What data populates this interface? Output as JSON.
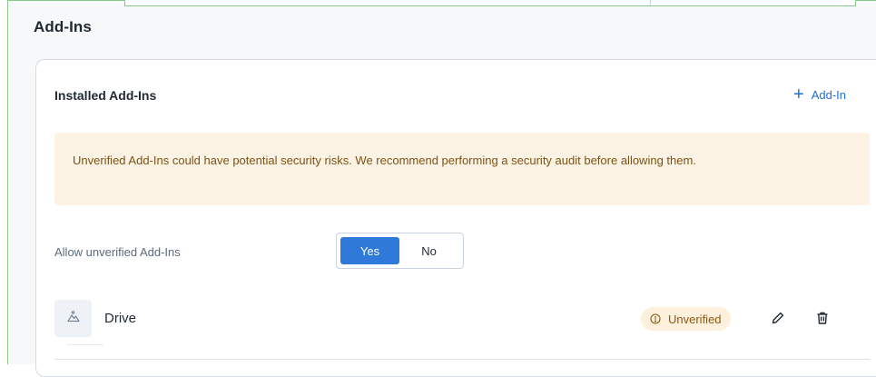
{
  "section": {
    "title": "Add-Ins"
  },
  "card": {
    "title": "Installed Add-Ins",
    "add_label": "Add-In",
    "add_icon": "plus-icon"
  },
  "warning": {
    "text": "Unverified Add-Ins could have potential security risks. We recommend performing a security audit before allowing them."
  },
  "allow_unverified": {
    "label": "Allow unverified Add-Ins",
    "options": [
      "Yes",
      "No"
    ],
    "selected": "Yes"
  },
  "addins": [
    {
      "name": "Drive",
      "icon": "image-placeholder-icon",
      "status": "Unverified",
      "status_icon": "info-circle-icon",
      "actions": [
        "edit-icon",
        "delete-icon"
      ]
    }
  ],
  "colors": {
    "accent": "#2f7ad9",
    "link": "#1f6fd1",
    "warning_bg": "#fdf3e4",
    "warning_text": "#7a5214",
    "badge_bg": "#fdf0dc",
    "panel_border": "#8bc98b"
  }
}
